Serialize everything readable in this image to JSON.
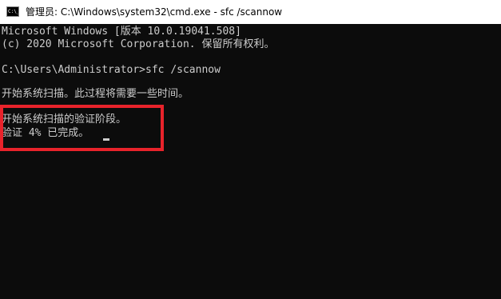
{
  "window": {
    "title": "管理员: C:\\Windows\\system32\\cmd.exe - sfc  /scannow",
    "icon": "cmd-icon",
    "icon_glyph": "C:\\_"
  },
  "console": {
    "lines": [
      "Microsoft Windows [版本 10.0.19041.508]",
      "(c) 2020 Microsoft Corporation. 保留所有权利。",
      "",
      "C:\\Users\\Administrator>sfc /scannow",
      "",
      "开始系统扫描。此过程将需要一些时间。",
      "",
      "开始系统扫描的验证阶段。",
      "验证 4% 已完成。"
    ],
    "progress_percent": 4
  },
  "colors": {
    "console_bg": "#0c0c0c",
    "console_text": "#cccccc",
    "highlight_border": "#e8232b",
    "titlebar_bg": "#ffffff"
  }
}
